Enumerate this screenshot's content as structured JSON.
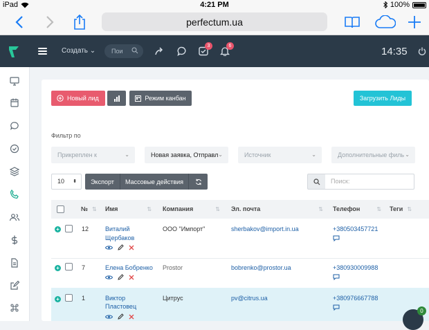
{
  "status_bar": {
    "device": "iPad",
    "time": "4:21 PM",
    "battery": "100%"
  },
  "browser": {
    "url": "perfectum.ua"
  },
  "topbar": {
    "create_label": "Создать",
    "search_placeholder": "Пои",
    "tasks_badge": "3",
    "notifications_badge": "6",
    "clock": "14:35"
  },
  "toolbar": {
    "new_lead": "Новый лид",
    "kanban": "Режим канбан",
    "upload": "Загрузить Лиды"
  },
  "filters": {
    "label": "Фильтр по",
    "attached": "Прикреплен к",
    "status": "Новая заявка, Отправл",
    "source": "Источник",
    "extra": "Дополнительные филь"
  },
  "list_controls": {
    "page_size": "10",
    "export": "Экспорт",
    "bulk": "Массовые действия",
    "search_placeholder": "Поиск:"
  },
  "table": {
    "headers": {
      "number": "№",
      "name": "Имя",
      "company": "Компания",
      "email": "Эл. почта",
      "phone": "Телефон",
      "tags": "Теги"
    },
    "rows": [
      {
        "id": "12",
        "name_line1": "Виталий",
        "name_line2": "Щербаков",
        "company": "ООО \"Импорт\"",
        "email": "sherbakov@import.in.ua",
        "phone": "+380503457721"
      },
      {
        "id": "7",
        "name_line1": "Елена Бобренко",
        "name_line2": "",
        "company": "Prostor",
        "email": "bobrenko@prostor.ua",
        "phone": "+380930009988"
      },
      {
        "id": "1",
        "name_line1": "Виктор",
        "name_line2": "Пластовец",
        "company": "Цитрус",
        "email": "pv@citrus.ua",
        "phone": "+380976667788"
      }
    ]
  },
  "chat": {
    "badge": "0"
  },
  "colors": {
    "topbar": "#2b3a48",
    "red": "#e85b6e",
    "cyan": "#23c3d6",
    "link": "#1d5fa6",
    "highlight": "#dff2f8"
  }
}
